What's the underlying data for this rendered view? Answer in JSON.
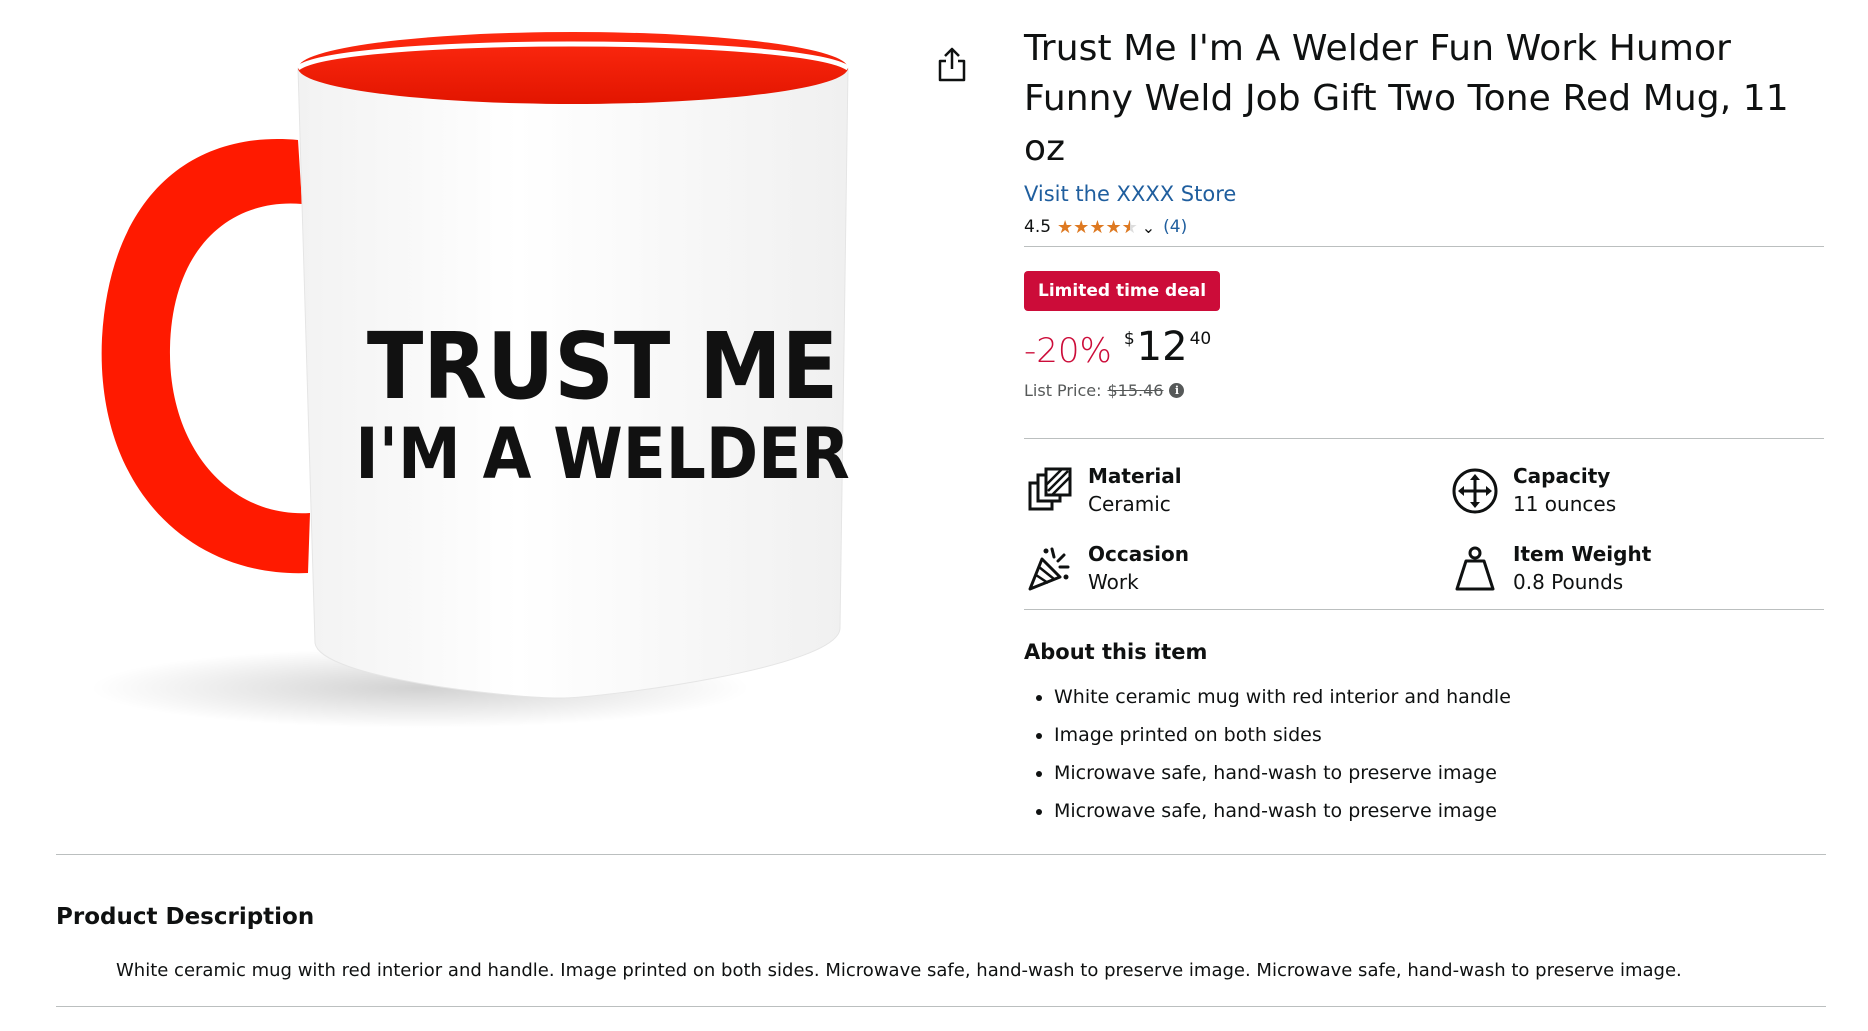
{
  "product": {
    "title": "Trust Me I'm A Welder Fun Work Humor Funny Weld Job Gift Two Tone Red Mug, 11 oz",
    "store_link": "Visit the XXXX Store",
    "rating": "4.5",
    "rating_value": 4.5,
    "rating_count": "(4)",
    "deal_badge": "Limited time deal",
    "discount": "-20%",
    "price_currency": "$",
    "price_whole": "12",
    "price_fraction": "40",
    "list_price_label": "List Price:",
    "list_price": "$15.46",
    "mug_text_line1": "TRUST ME",
    "mug_text_line2": "I'M A WELDER"
  },
  "specs": [
    {
      "label": "Material",
      "value": "Ceramic",
      "icon": "material-icon"
    },
    {
      "label": "Capacity",
      "value": "11 ounces",
      "icon": "capacity-icon"
    },
    {
      "label": "Occasion",
      "value": "Work",
      "icon": "party-popper-icon"
    },
    {
      "label": "Item Weight",
      "value": "0.8 Pounds",
      "icon": "weight-icon"
    }
  ],
  "about": {
    "heading": "About this item",
    "bullets": [
      "White ceramic mug with red interior and handle",
      "Image printed on both sides",
      "Microwave safe, hand-wash to preserve image",
      "Microwave safe, hand-wash to preserve image"
    ]
  },
  "description": {
    "heading": "Product Description",
    "text": "White ceramic mug with red interior and handle. Image printed on both sides. Microwave safe, hand-wash to preserve image. Microwave safe, hand-wash to preserve image."
  },
  "colors": {
    "mug_red": "#FF1A00",
    "deal_red": "#CC0C39",
    "link_blue": "#1F5E9E",
    "star_orange": "#DE7921"
  }
}
